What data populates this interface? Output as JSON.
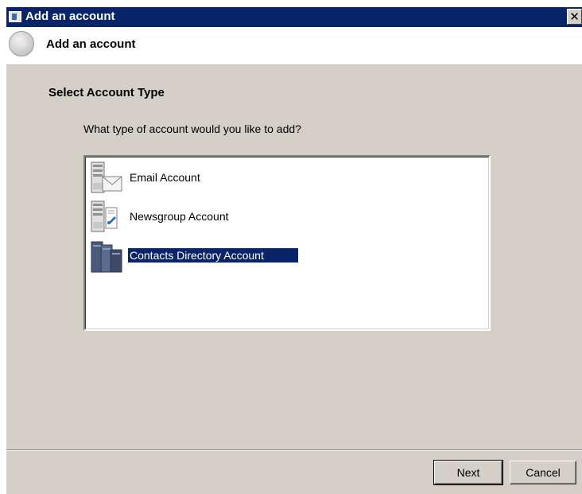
{
  "window": {
    "title": "Add an account",
    "close_symbol": "✕"
  },
  "header": {
    "title": "Add an account",
    "back_icon": "back-arrow-icon"
  },
  "main": {
    "heading": "Select Account Type",
    "question": "What type of account would you like to add?",
    "account_types": [
      {
        "label": "Email Account",
        "icon": "email-account-icon",
        "selected": false
      },
      {
        "label": "Newsgroup Account",
        "icon": "newsgroup-account-icon",
        "selected": false
      },
      {
        "label": "Contacts Directory Account",
        "icon": "contacts-directory-icon",
        "selected": true
      }
    ]
  },
  "footer": {
    "next_label": "Next",
    "cancel_label": "Cancel"
  },
  "colors": {
    "titlebar": "#0a246a",
    "face": "#d4d0c8",
    "selection": "#0a246a"
  }
}
